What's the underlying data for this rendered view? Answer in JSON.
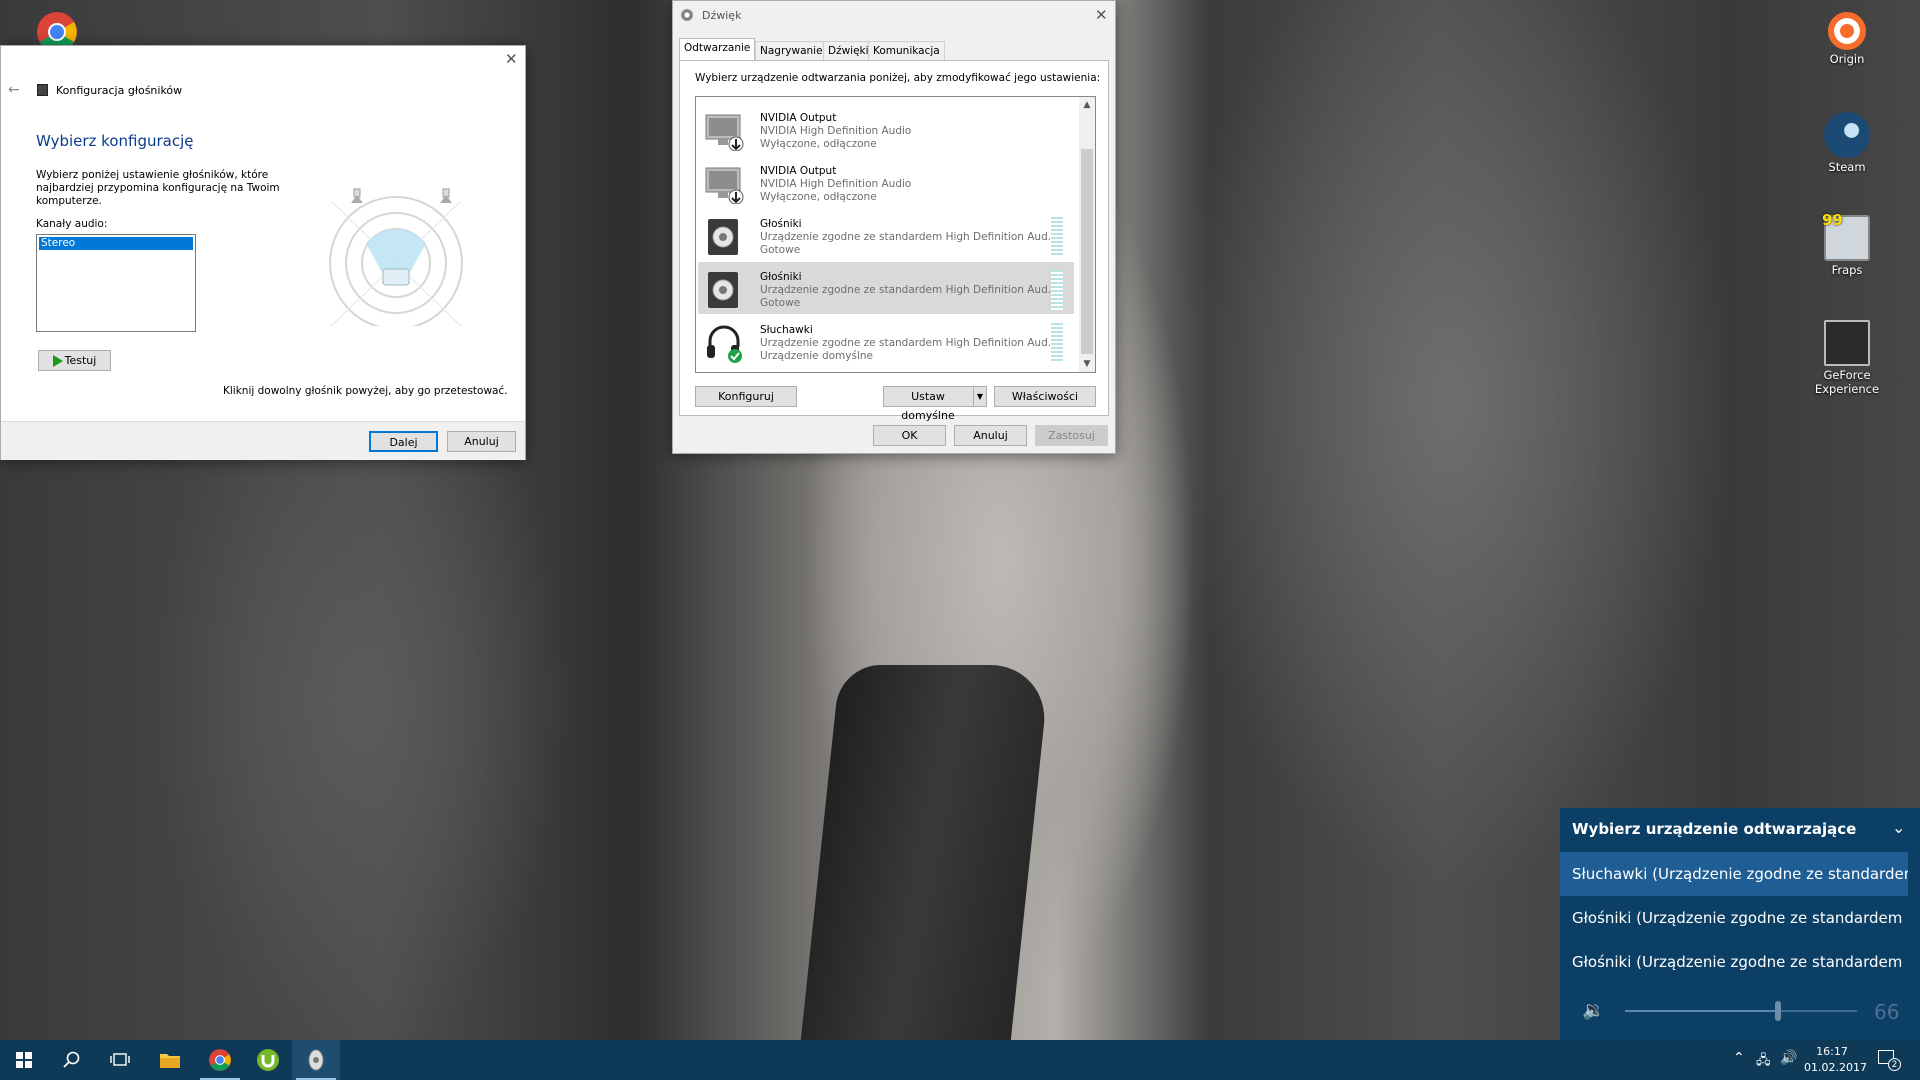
{
  "speaker_config": {
    "title": "Konfiguracja głośników",
    "heading": "Wybierz konfigurację",
    "description": "Wybierz poniżej ustawienie głośników, które najbardziej przypomina konfigurację na Twoim komputerze.",
    "channels_label": "Kanały audio:",
    "channels": [
      "Stereo"
    ],
    "selected_channel": "Stereo",
    "test_label": "Testuj",
    "hint": "Kliknij dowolny głośnik powyżej, aby go przetestować.",
    "next_label": "Dalej",
    "cancel_label": "Anuluj"
  },
  "sound": {
    "title": "Dźwięk",
    "tabs": [
      {
        "label": "Odtwarzanie",
        "active": true
      },
      {
        "label": "Nagrywanie",
        "active": false
      },
      {
        "label": "Dźwięki",
        "active": false
      },
      {
        "label": "Komunikacja",
        "active": false
      }
    ],
    "instruction": "Wybierz urządzenie odtwarzania poniżej, aby zmodyfikować jego ustawienia:",
    "devices": [
      {
        "name": "NVIDIA Output",
        "desc": "NVIDIA High Definition Audio",
        "status": "Wyłączone, odłączone",
        "icon": "monitor-icon",
        "selected": false
      },
      {
        "name": "NVIDIA Output",
        "desc": "NVIDIA High Definition Audio",
        "status": "Wyłączone, odłączone",
        "icon": "monitor-icon",
        "selected": false
      },
      {
        "name": "Głośniki",
        "desc": "Urządzenie zgodne ze standardem High Definition Aud...",
        "status": "Gotowe",
        "icon": "speaker-icon",
        "selected": false
      },
      {
        "name": "Głośniki",
        "desc": "Urządzenie zgodne ze standardem High Definition Aud...",
        "status": "Gotowe",
        "icon": "speaker-icon",
        "selected": true
      },
      {
        "name": "Słuchawki",
        "desc": "Urządzenie zgodne ze standardem High Definition Aud...",
        "status": "Urządzenie domyślne",
        "icon": "headphones-icon",
        "selected": false
      }
    ],
    "configure_label": "Konfiguruj",
    "set_default_label": "Ustaw domyślne",
    "properties_label": "Właściwości",
    "ok_label": "OK",
    "cancel_label": "Anuluj",
    "apply_label": "Zastosuj"
  },
  "desktop_icons": [
    {
      "label": "Origin",
      "icon": "origin-icon"
    },
    {
      "label": "Steam",
      "icon": "steam-icon"
    },
    {
      "label": "Fraps",
      "icon": "fraps-icon"
    },
    {
      "label": "GeForce Experience",
      "icon": "geforce-icon"
    }
  ],
  "flyout": {
    "title": "Wybierz urządzenie odtwarzające",
    "items": [
      "Słuchawki (Urządzenie zgodne ze standardem High",
      "Głośniki (Urządzenie zgodne ze standardem High D",
      "Głośniki (Urządzenie zgodne ze standardem High D"
    ],
    "volume": "66"
  },
  "taskbar": {
    "time": "16:17",
    "date": "01.02.2017",
    "notifications": "2"
  },
  "colors": {
    "accent": "#0078d7",
    "flyout_bg": "#0c3f66",
    "flyout_selected": "#1f5e94",
    "taskbar_bg": "#0e3a57",
    "heading_blue": "#0a3c8c"
  }
}
